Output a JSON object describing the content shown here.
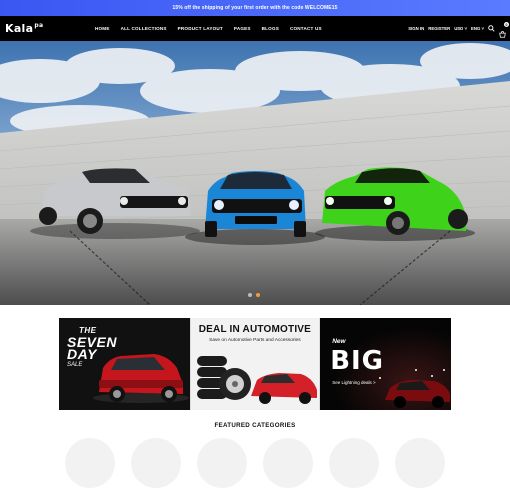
{
  "announcement": "15% off the shipping of your first order with the code WELCOME15",
  "header": {
    "logo": "Kala",
    "logo_sub": "pa",
    "nav": [
      "HOME",
      "ALL COLLECTIONS",
      "PRODUCT LAYOUT",
      "PAGES",
      "BLOGS",
      "CONTACT US"
    ],
    "sign_in": "SIGN IN",
    "register": "REGISTER",
    "currency": "USD",
    "language": "ENG",
    "cart_count": "0"
  },
  "hero": {
    "cars": [
      "silver car",
      "blue car",
      "green car"
    ],
    "colors": {
      "silver": "#c7c9cc",
      "blue": "#1c86d6",
      "green": "#3ed21b"
    }
  },
  "slider": {
    "active_index": 1,
    "count": 2
  },
  "banners": [
    {
      "line1": "THE",
      "line2": "SEVEN",
      "line3": "DAY",
      "line4": "SALE"
    },
    {
      "heading": "DEAL IN AUTOMOTIVE",
      "sub": "Save on Automotive Parts and Accessories"
    },
    {
      "line1": "New",
      "line2": "BIG",
      "line3": "See Lightning deals >"
    }
  ],
  "featured": {
    "title": "FEATURED CATEGORIES",
    "count": 6
  }
}
